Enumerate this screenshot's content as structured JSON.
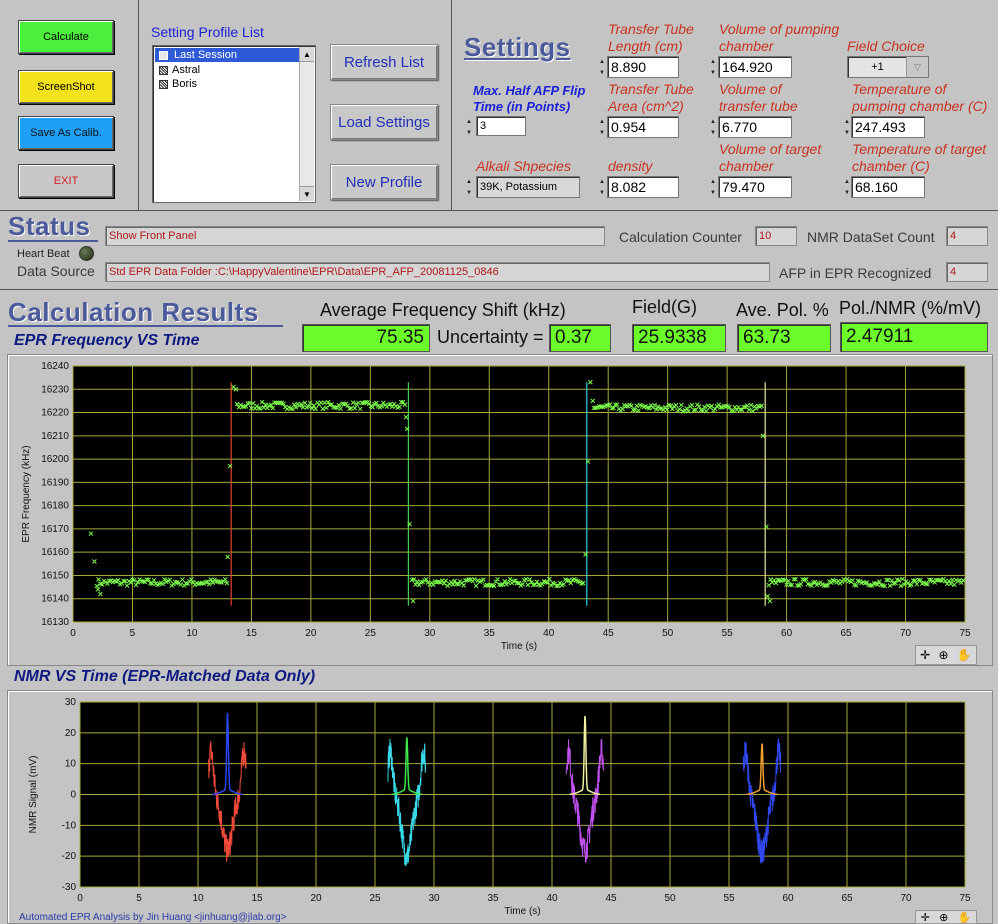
{
  "buttons": {
    "calculate": "Calculate",
    "screenshot": "ScreenShot",
    "save_calib": "Save As Calib.",
    "exit": "EXIT",
    "refresh": "Refresh List",
    "load": "Load Settings",
    "new_profile": "New Profile"
  },
  "profile_list": {
    "title": "Setting Profile List",
    "items": [
      "Last Session",
      "Astral",
      "Boris"
    ]
  },
  "settings": {
    "title": "Settings",
    "flip_time_label": "Max. Half AFP Flip Time (in Points)",
    "flip_time_value": "3",
    "alkali_label": "Alkali Shpecies",
    "alkali_value": "39K, Potassium",
    "tt_length_label": "Transfer Tube Length (cm)",
    "tt_length_value": "8.890",
    "tt_area_label": "Transfer Tube Area (cm^2)",
    "tt_area_value": "0.954",
    "density_label": "density",
    "density_value": "8.082",
    "vol_pump_label": "Volume of pumping chamber",
    "vol_pump_value": "164.920",
    "vol_tt_label": "Volume of transfer tube",
    "vol_tt_value": "6.770",
    "vol_target_label": "Volume of target chamber",
    "vol_target_value": "79.470",
    "field_choice_label": "Field Choice",
    "field_choice_value": "+1",
    "temp_pump_label": "Temperature of pumping chamber (C)",
    "temp_pump_value": "247.493",
    "temp_target_label": "Temperature of target chamber (C)",
    "temp_target_value": "68.160"
  },
  "status": {
    "title": "Status",
    "message": "Show Front Panel",
    "heartbeat_label": "Heart Beat",
    "data_source_label": "Data Source",
    "data_source_value": "Std EPR Data Folder :C:\\HappyValentine\\EPR\\Data\\EPR_AFP_20081125_0846",
    "calc_counter_label": "Calculation Counter",
    "calc_counter_value": "10",
    "nmr_count_label": "NMR DataSet Count",
    "nmr_count_value": "4",
    "afp_label": "AFP in EPR Recognized",
    "afp_value": "4"
  },
  "results": {
    "title": "Calculation Results",
    "avg_shift_label": "Average Frequency Shift (kHz)",
    "avg_shift_value": "75.35",
    "uncertainty_label": "Uncertainty =",
    "uncertainty_value": "0.37",
    "field_label": "Field(G)",
    "field_value": "25.9338",
    "pol_label": "Ave. Pol. %",
    "pol_value": "63.73",
    "pol_nmr_label": "Pol./NMR (%/mV)",
    "pol_nmr_value": "2.47911"
  },
  "footer": "Automated EPR Analysis by Jin Huang <jinhuang@jlab.org>",
  "chart_data": [
    {
      "type": "scatter",
      "title": "EPR Frequency VS Time",
      "xlabel": "Time (s)",
      "ylabel": "EPR Frequency (kHz)",
      "xlim": [
        0,
        75
      ],
      "ylim": [
        16130,
        16240
      ],
      "xticks": [
        0,
        5,
        10,
        15,
        20,
        25,
        30,
        35,
        40,
        45,
        50,
        55,
        60,
        65,
        70,
        75
      ],
      "yticks": [
        16130,
        16140,
        16150,
        16160,
        16170,
        16180,
        16190,
        16200,
        16210,
        16220,
        16230,
        16240
      ],
      "grid": true,
      "plateaus": [
        {
          "x0": 2.0,
          "x1": 13.0,
          "y": 16147
        },
        {
          "x0": 13.8,
          "x1": 28.0,
          "y": 16223
        },
        {
          "x0": 28.5,
          "x1": 43.0,
          "y": 16147
        },
        {
          "x0": 43.8,
          "x1": 58.0,
          "y": 16222
        },
        {
          "x0": 58.5,
          "x1": 75.0,
          "y": 16147
        }
      ],
      "outliers": [
        {
          "x": 1.5,
          "y": 16168
        },
        {
          "x": 1.8,
          "y": 16156
        },
        {
          "x": 2.1,
          "y": 16144
        },
        {
          "x": 2.3,
          "y": 16142
        },
        {
          "x": 13.2,
          "y": 16197
        },
        {
          "x": 13.5,
          "y": 16231
        },
        {
          "x": 13.7,
          "y": 16230
        },
        {
          "x": 13.0,
          "y": 16158
        },
        {
          "x": 28.1,
          "y": 16213
        },
        {
          "x": 28.3,
          "y": 16172
        },
        {
          "x": 28.6,
          "y": 16139
        },
        {
          "x": 28.0,
          "y": 16218
        },
        {
          "x": 43.3,
          "y": 16199
        },
        {
          "x": 43.5,
          "y": 16233
        },
        {
          "x": 43.1,
          "y": 16159
        },
        {
          "x": 43.7,
          "y": 16225
        },
        {
          "x": 58.0,
          "y": 16210
        },
        {
          "x": 58.3,
          "y": 16171
        },
        {
          "x": 58.6,
          "y": 16139
        },
        {
          "x": 58.4,
          "y": 16141
        }
      ],
      "afp_markers": [
        {
          "x": 13.3,
          "y0": 16137,
          "y1": 16233,
          "color": "#e8402e"
        },
        {
          "x": 28.2,
          "y0": 16137,
          "y1": 16233,
          "color": "#46d050"
        },
        {
          "x": 43.2,
          "y0": 16137,
          "y1": 16233,
          "color": "#2ad0e8"
        },
        {
          "x": 58.2,
          "y0": 16137,
          "y1": 16233,
          "color": "#e8e8a0"
        }
      ],
      "point_color": "#7cfc4c"
    },
    {
      "type": "line",
      "title": "NMR VS Time (EPR-Matched Data Only)",
      "xlabel": "Time (s)",
      "ylabel": "NMR Signal (mV)",
      "xlim": [
        0,
        75
      ],
      "ylim": [
        -30,
        30
      ],
      "xticks": [
        0,
        5,
        10,
        15,
        20,
        25,
        30,
        35,
        40,
        45,
        50,
        55,
        60,
        65,
        70,
        75
      ],
      "yticks": [
        -30,
        -20,
        -10,
        0,
        10,
        20,
        30
      ],
      "grid": true,
      "sweeps": [
        {
          "center": 12.5,
          "raw_color": "#f04a3a",
          "fit_color": "#2a46f0",
          "depth": -18,
          "peak": 25
        },
        {
          "center": 27.7,
          "raw_color": "#3ad8e8",
          "fit_color": "#3ae84a",
          "depth": -20,
          "peak": 17
        },
        {
          "center": 42.8,
          "raw_color": "#c050f0",
          "fit_color": "#f0f0a0",
          "depth": -18,
          "peak": 24
        },
        {
          "center": 57.8,
          "raw_color": "#3048f0",
          "fit_color": "#f0a030",
          "depth": -19,
          "peak": 15
        }
      ]
    }
  ]
}
